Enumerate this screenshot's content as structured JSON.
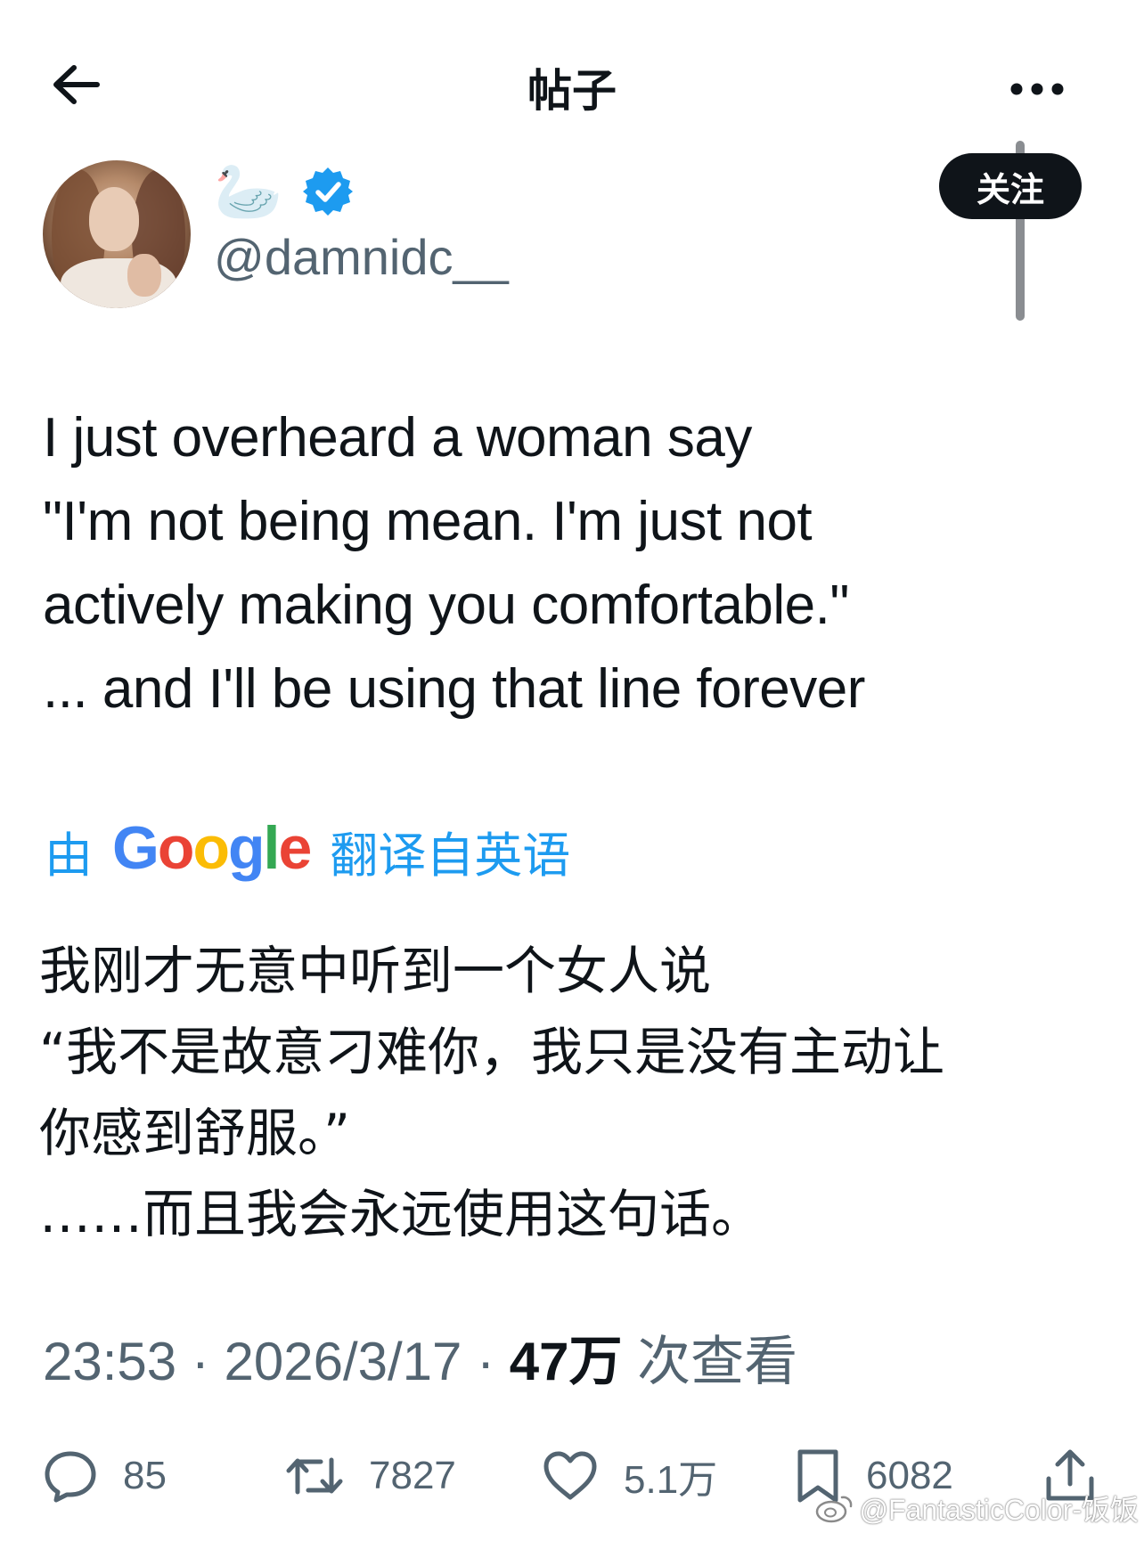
{
  "header": {
    "title": "帖子"
  },
  "author": {
    "display_name": "🦢",
    "handle": "@damnidc__",
    "verified": true
  },
  "follow_button": {
    "label": "关注"
  },
  "tweet": {
    "lines": [
      "I just overheard a woman say",
      "\"I'm not being mean. I'm just not",
      "actively making you comfortable.\"",
      "... and I'll be using that line forever"
    ]
  },
  "translation": {
    "prefix": "由",
    "provider": "Google",
    "suffix": "翻译自英语",
    "lines": [
      "我刚才无意中听到一个女人说",
      "“我不是故意刁难你，我只是没有主动让",
      "你感到舒服。”",
      "……而且我会永远使用这句话。"
    ]
  },
  "meta": {
    "time": "23:53",
    "sep1": " · ",
    "date": "2026/3/17",
    "sep2": " · ",
    "views_count": "47万",
    "views_label": " 次查看"
  },
  "actions": {
    "replies": "85",
    "reposts": "7827",
    "likes": "5.1万",
    "bookmarks": "6082"
  },
  "watermark": {
    "text": "@FantasticColor-饭饭"
  },
  "colors": {
    "accent": "#1d9bf0",
    "text": "#0f1419",
    "secondary": "#536471",
    "google_blue": "#4285F4",
    "google_red": "#EA4335",
    "google_yellow": "#FBBC05",
    "google_green": "#34A853"
  }
}
